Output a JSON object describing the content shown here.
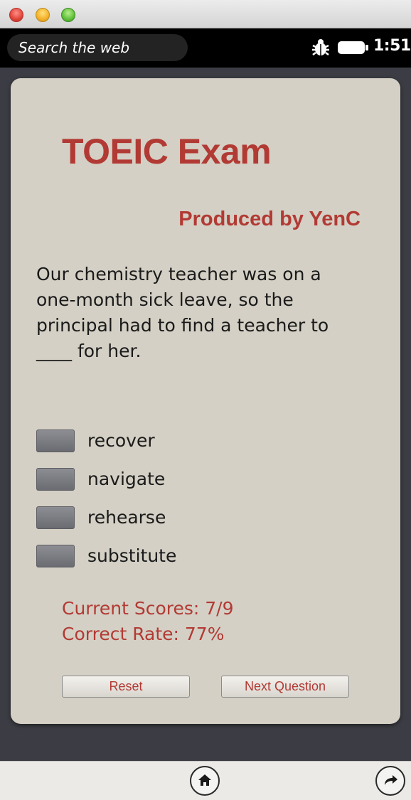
{
  "status_bar": {
    "search_placeholder": "Search the web",
    "time": "1:51",
    "icons": [
      "bug-icon",
      "battery-icon"
    ]
  },
  "exam": {
    "title": "TOEIC Exam",
    "subtitle": "Produced by YenC",
    "question": "Our chemistry teacher was on a one-month sick leave, so the principal had to find a teacher to ____ for her.",
    "options": [
      {
        "label": "recover"
      },
      {
        "label": "navigate"
      },
      {
        "label": "rehearse"
      },
      {
        "label": "substitute"
      }
    ],
    "score_line": "Current Scores: 7/9",
    "rate_line": "Correct Rate: 77%",
    "reset_label": "Reset",
    "next_label": "Next Question"
  },
  "bottom_bar": {
    "icons": [
      "home-icon",
      "redo-icon"
    ]
  },
  "colors": {
    "accent": "#b23a34",
    "card_background": "#d4d0c5",
    "frame_background": "#3c3d44"
  }
}
